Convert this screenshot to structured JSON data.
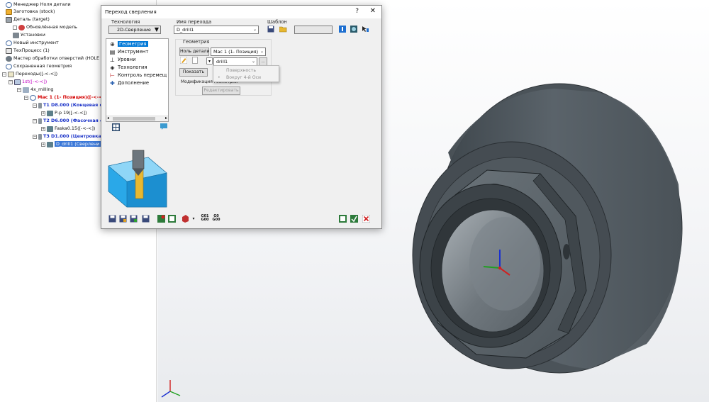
{
  "tree": {
    "items": [
      {
        "label": "Менеджер Ноля детали"
      },
      {
        "label": "Заготовка (stock)"
      },
      {
        "label": "Деталь (target)"
      },
      {
        "label": "Обновлённая модель"
      },
      {
        "label": "Установки"
      },
      {
        "label": "Новый инструмент"
      },
      {
        "label": "ТехПроцесс (1)"
      },
      {
        "label": "Мастер обработки отверстий (HOLE PROCESS"
      },
      {
        "label": "Сохраненная геометрия"
      },
      {
        "label": "Переходы([-<-<])"
      },
      {
        "label": "1st([-<-<])"
      },
      {
        "label": "4x_milling"
      },
      {
        "label": "Мас 1 (1- Позиция)([-<-<])"
      },
      {
        "label": "T1 D8.000 (Концевая ф"
      },
      {
        "label": "P-p 19([-<-<])"
      },
      {
        "label": "T2 D6.000 (Фасочная ф"
      },
      {
        "label": "Faska0.15([-<-<])"
      },
      {
        "label": "T3 D1.000 (Центровка"
      },
      {
        "label": "D_drill1 (Сверлени"
      }
    ]
  },
  "dialog": {
    "title": "Переход сверления",
    "help": "?",
    "close": "✕",
    "technology_label": "Технология",
    "technology_value": "2D-Сверление",
    "name_label": "Имя перехода",
    "name_value": "D_drill1",
    "template_label": "Шаблон",
    "template_value": "",
    "tech_tree": [
      {
        "label": "Геометрия",
        "icon": "geometry-icon",
        "selected": true
      },
      {
        "label": "Инструмент",
        "icon": "tool-icon"
      },
      {
        "label": "Уровни",
        "icon": "levels-icon"
      },
      {
        "label": "Технология",
        "icon": "technology-icon"
      },
      {
        "label": "Контроль перемещ",
        "icon": "motion-control-icon"
      },
      {
        "label": "Дополнение",
        "icon": "extra-icon"
      }
    ],
    "geometry": {
      "group_label": "Геометрия",
      "part_zero_button": "Ноль детали",
      "part_zero_value": "Мас 1 (1- Позиция)",
      "geom_value": "drill1",
      "more_button": "...",
      "show_button": "Показать",
      "mod_label": "Модификация геометрии",
      "edit_button": "Редактировать"
    },
    "context_menu": {
      "items": [
        "Поверхность",
        "Вокруг 4-й Оси"
      ]
    },
    "toolbar": {
      "g01_top": "G01",
      "g01_bottom": "G00",
      "g00_top": "G0",
      "g00_bottom": "G00"
    }
  },
  "colors": {
    "accent": "#0078d7",
    "part": "#59636a",
    "tree_red": "#d40000",
    "tree_blue": "#1a32c8"
  }
}
